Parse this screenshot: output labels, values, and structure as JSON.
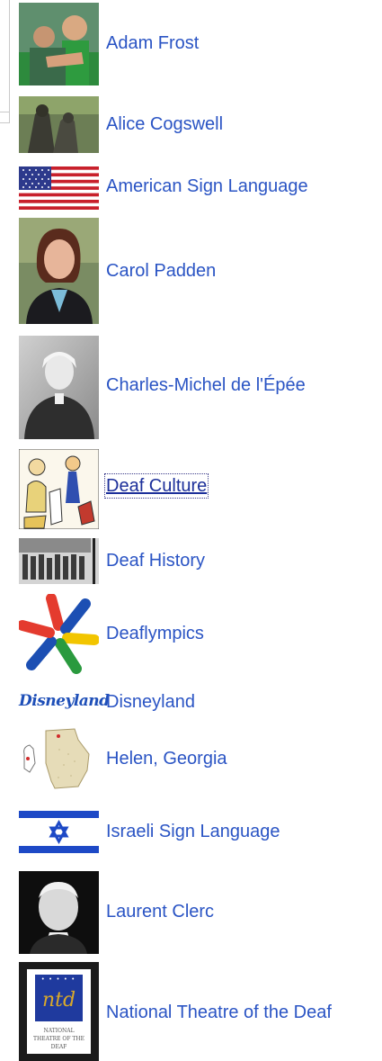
{
  "items": [
    {
      "label": "Adam Frost",
      "icon": "adam-frost-photo"
    },
    {
      "label": "Alice Cogswell",
      "icon": "alice-cogswell-statue-photo"
    },
    {
      "label": "American Sign Language",
      "icon": "us-flag-icon"
    },
    {
      "label": "Carol Padden",
      "icon": "carol-padden-photo"
    },
    {
      "label": "Charles-Michel de l'Épée",
      "icon": "charles-michel-portrait"
    },
    {
      "label": "Deaf Culture",
      "icon": "deaf-culture-illustration"
    },
    {
      "label": "Deaf History",
      "icon": "deaf-history-photo"
    },
    {
      "label": "Deaflympics",
      "icon": "deaflympics-logo"
    },
    {
      "label": "Disneyland",
      "icon": "disneyland-logo",
      "logo_text": "Disneyland"
    },
    {
      "label": "Helen, Georgia",
      "icon": "georgia-map"
    },
    {
      "label": "Israeli Sign Language",
      "icon": "israel-flag-icon"
    },
    {
      "label": "Laurent Clerc",
      "icon": "laurent-clerc-portrait"
    },
    {
      "label": "National Theatre of the Deaf",
      "icon": "ntd-logo",
      "logo_text": "ntd",
      "logo_caption": "NATIONAL THEATRE OF THE DEAF"
    }
  ],
  "focused_item": "Deaf Culture",
  "colors": {
    "link": "#2a54c4",
    "background": "#ffffff"
  }
}
